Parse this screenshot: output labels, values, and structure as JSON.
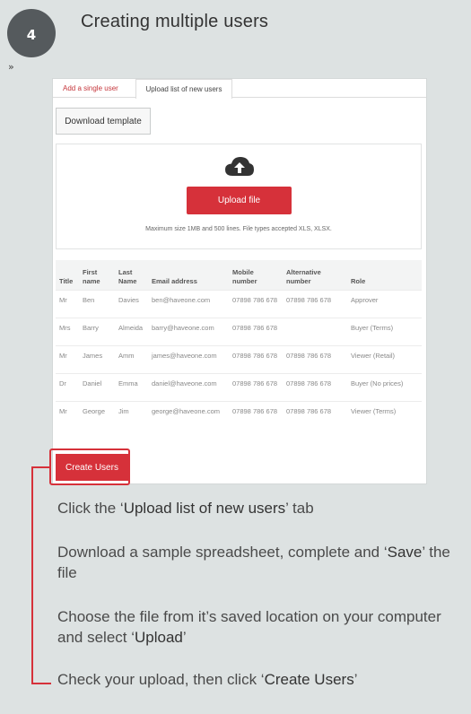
{
  "step": {
    "number": "4",
    "title": "Creating multiple users"
  },
  "tabs": [
    {
      "label": "Add a single user"
    },
    {
      "label": "Upload list of new users"
    }
  ],
  "download_button": "Download template",
  "upload": {
    "button": "Upload file",
    "hint": "Maximum size 1MB and 500 lines. File types accepted XLS, XLSX."
  },
  "table": {
    "headers": {
      "title": "Title",
      "first": "First name",
      "last": "Last Name",
      "email": "Email address",
      "mobile": "Mobile number",
      "alt": "Alternative number",
      "role": "Role"
    },
    "rows": [
      {
        "title": "Mr",
        "first": "Ben",
        "last": "Davies",
        "email": "ben@haveone.com",
        "mobile": "07898 786 678",
        "alt": "07898 786 678",
        "role": "Approver"
      },
      {
        "title": "Mrs",
        "first": "Barry",
        "last": "Almeida",
        "email": "barry@haveone.com",
        "mobile": "07898 786 678",
        "alt": "",
        "role": "Buyer (Terms)"
      },
      {
        "title": "Mr",
        "first": "James",
        "last": "Amm",
        "email": "james@haveone.com",
        "mobile": "07898 786 678",
        "alt": "07898 786 678",
        "role": "Viewer (Retail)"
      },
      {
        "title": "Dr",
        "first": "Daniel",
        "last": "Emma",
        "email": "daniel@haveone.com",
        "mobile": "07898 786 678",
        "alt": "07898 786 678",
        "role": "Buyer (No prices)"
      },
      {
        "title": "Mr",
        "first": "George",
        "last": "Jim",
        "email": "george@haveone.com",
        "mobile": "07898 786 678",
        "alt": "07898 786 678",
        "role": "Viewer (Terms)"
      }
    ]
  },
  "create_button": "Create Users",
  "instructions": {
    "i1_a": "Click the ‘",
    "i1_b": "Upload list of new users",
    "i1_c": "’ tab",
    "i2_a": "Download a sample spreadsheet, complete and ‘",
    "i2_b": "Save",
    "i2_c": "’ the file",
    "i3_a": "Choose the file from it’s saved location on your computer and select ‘",
    "i3_b": "Upload",
    "i3_c": "’",
    "i4_a": "Check your upload, then click ‘",
    "i4_b": "Create Users",
    "i4_c": "’"
  },
  "colors": {
    "accent": "#d6313a",
    "background": "#dde2e2",
    "step_circle": "#555a5d"
  }
}
